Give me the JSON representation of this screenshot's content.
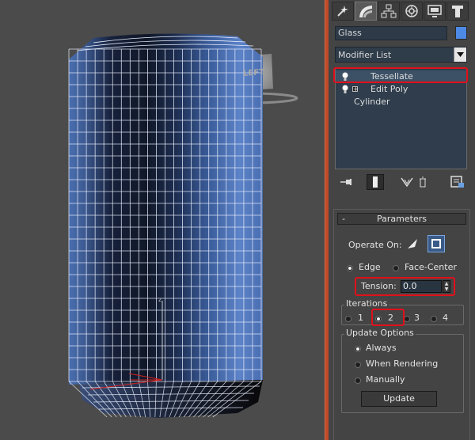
{
  "viewport": {
    "viewcube_face": "LEFT",
    "axis_label": "z"
  },
  "panel": {
    "tabs": [
      {
        "icon": "create-icon"
      },
      {
        "icon": "modify-icon"
      },
      {
        "icon": "hierarchy-icon"
      },
      {
        "icon": "motion-icon"
      },
      {
        "icon": "display-icon"
      },
      {
        "icon": "utilities-icon"
      }
    ],
    "object_name": "Glass",
    "object_color": "#4d8ae6",
    "modifier_list_label": "Modifier List",
    "stack": {
      "items": [
        {
          "label": "Tessellate",
          "selected": true
        },
        {
          "label": "Edit Poly",
          "selected": false
        },
        {
          "label": "Cylinder",
          "selected": false
        }
      ]
    }
  },
  "parameters": {
    "header": "Parameters",
    "collapse_symbol": "-",
    "operate_on_label": "Operate On:",
    "edge_label": "Edge",
    "face_center_label": "Face-Center",
    "tension_label": "Tension:",
    "tension_value": "0.0",
    "iterations_label": "Iterations",
    "iterations": [
      {
        "label": "1",
        "selected": false
      },
      {
        "label": "2",
        "selected": true
      },
      {
        "label": "3",
        "selected": false
      },
      {
        "label": "4",
        "selected": false
      }
    ],
    "update_options_label": "Update Options",
    "update_options": [
      {
        "label": "Always",
        "selected": true
      },
      {
        "label": "When Rendering",
        "selected": false
      },
      {
        "label": "Manually",
        "selected": false
      }
    ],
    "update_button_label": "Update"
  }
}
